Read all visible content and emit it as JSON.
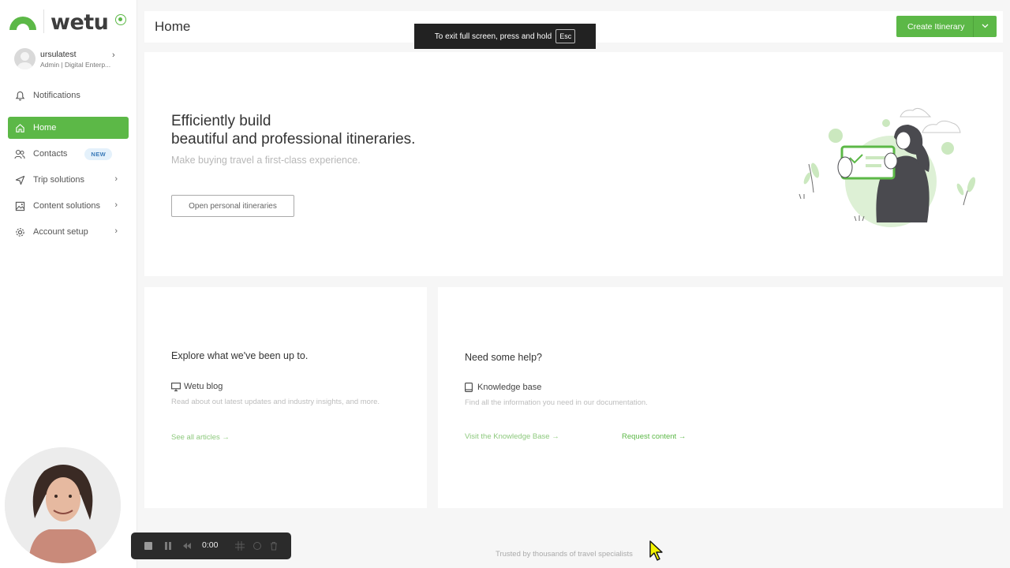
{
  "brand": {
    "name": "wetu",
    "accent": "#5cb847"
  },
  "user": {
    "name": "ursulatest",
    "role": "Admin | Digital Enterp..."
  },
  "sidebar": {
    "items": [
      {
        "label": "Notifications",
        "icon": "bell-icon"
      },
      {
        "label": "Home",
        "icon": "home-icon",
        "active": true
      },
      {
        "label": "Contacts",
        "icon": "contacts-icon",
        "badge": "NEW"
      },
      {
        "label": "Trip solutions",
        "icon": "send-icon",
        "has_submenu": true
      },
      {
        "label": "Content solutions",
        "icon": "image-icon",
        "has_submenu": true
      },
      {
        "label": "Account setup",
        "icon": "gear-icon",
        "has_submenu": true
      }
    ]
  },
  "header": {
    "title": "Home",
    "create_label": "Create Itinerary"
  },
  "fullscreen": {
    "message": "To exit full screen, press and hold",
    "key": "Esc"
  },
  "hero": {
    "title_line1": "Efficiently build",
    "title_line2": "beautiful and professional itineraries.",
    "subtitle": "Make buying travel a first-class experience.",
    "button": "Open personal itineraries"
  },
  "blog_card": {
    "title": "Explore what we've been up to.",
    "sub_title": "Wetu blog",
    "description": "Read about out latest updates and industry insights, and more.",
    "link": "See all articles →"
  },
  "help_card": {
    "title": "Need some help?",
    "sub_title": "Knowledge base",
    "description": "Find all the information you need in our documentation.",
    "link_kb": "Visit the Knowledge Base →",
    "link_request": "Request content →"
  },
  "footer": {
    "note": "Trusted by thousands of travel specialists"
  },
  "recorder": {
    "time": "0:00"
  }
}
